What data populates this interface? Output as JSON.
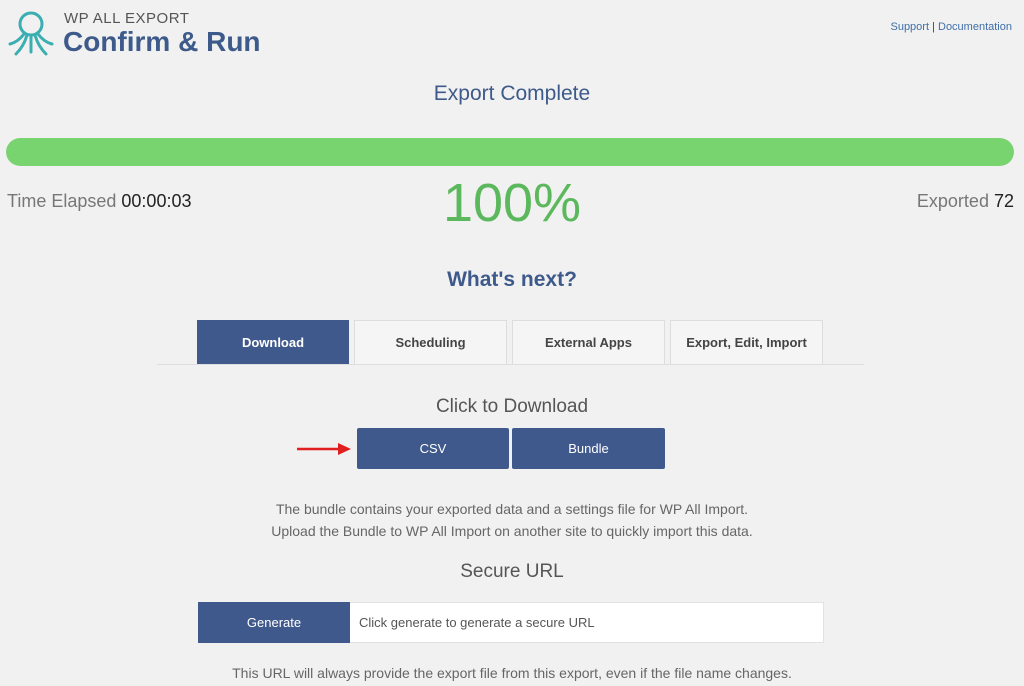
{
  "header": {
    "brand_small": "WP ALL EXPORT",
    "title": "Confirm & Run",
    "support_link": "Support",
    "separator": "|",
    "docs_link": "Documentation",
    "logo_icon": "octopus-logo-icon"
  },
  "status": {
    "title": "Export Complete",
    "progress_percent": 100,
    "percent_text": "100%",
    "time_elapsed_label": "Time Elapsed",
    "time_elapsed_value": "00:00:03",
    "exported_label": "Exported",
    "exported_value": "72"
  },
  "next": {
    "title": "What's next?",
    "tabs": [
      {
        "label": "Download",
        "active": true
      },
      {
        "label": "Scheduling",
        "active": false
      },
      {
        "label": "External Apps",
        "active": false
      },
      {
        "label": "Export, Edit, Import",
        "active": false
      }
    ]
  },
  "download": {
    "title": "Click to Download",
    "csv_label": "CSV",
    "bundle_label": "Bundle",
    "description_line1": "The bundle contains your exported data and a settings file for WP All Import.",
    "description_line2": "Upload the Bundle to WP All Import on another site to quickly import this data."
  },
  "secure_url": {
    "title": "Secure URL",
    "generate_label": "Generate",
    "placeholder": "Click generate to generate a secure URL",
    "value": "",
    "footnote": "This URL will always provide the export file from this export, even if the file name changes."
  },
  "colors": {
    "brand": "#40598d",
    "progress": "#78d46f",
    "percent": "#5cb85c",
    "arrow": "#e02020"
  }
}
